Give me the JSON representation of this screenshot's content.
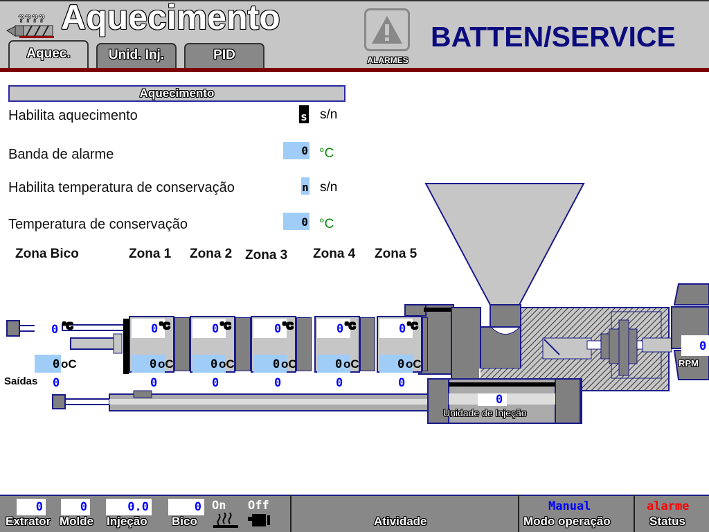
{
  "header": {
    "title": "Aquecimento",
    "tabs": [
      {
        "label": "Aquec.",
        "active": true
      },
      {
        "label": "Unid. Inj.",
        "active": false
      },
      {
        "label": "PID",
        "active": false
      }
    ],
    "alarm_button_label": "ALARMES",
    "brand": "BATTEN/SERVICE"
  },
  "section": {
    "title": "Aquecimento",
    "rows": [
      {
        "label": "Habilita aquecimento",
        "value": "s",
        "unit": "s/n"
      },
      {
        "label": "Banda de alarme",
        "value": "0",
        "unit": "°C"
      },
      {
        "label": "Habilita temperatura de conservação",
        "value": "n",
        "unit": "s/n"
      },
      {
        "label": "Temperatura de conservação",
        "value": "0",
        "unit": "°C"
      }
    ]
  },
  "zones": {
    "labels": [
      "Zona Bico",
      "Zona 1",
      "Zona 2",
      "Zona 3",
      "Zona 4",
      "Zona 5"
    ],
    "setpoint_unit": "°C",
    "actual_unit": "oC",
    "outputs_label": "Saídas",
    "items": [
      {
        "setpoint": "0",
        "actual": "0",
        "output": "0"
      },
      {
        "setpoint": "0",
        "actual": "0",
        "output": "0"
      },
      {
        "setpoint": "0",
        "actual": "0",
        "output": "0"
      },
      {
        "setpoint": "0",
        "actual": "0",
        "output": "0"
      },
      {
        "setpoint": "0",
        "actual": "0",
        "output": "0"
      },
      {
        "setpoint": "0",
        "actual": "0",
        "output": "0"
      }
    ]
  },
  "injection_unit": {
    "label": "Unidade de Injeção",
    "value": "0"
  },
  "motor": {
    "label": "RPM",
    "value": "0"
  },
  "footer": {
    "fields": [
      {
        "label": "Extrator",
        "value": "0"
      },
      {
        "label": "Molde",
        "value": "0"
      },
      {
        "label": "Injeção",
        "value": "0.0"
      },
      {
        "label": "Bico",
        "value": "0"
      }
    ],
    "heater_state": "On",
    "motor_state": "Off",
    "activity_label": "Atividade",
    "mode_value": "Manual",
    "mode_label": "Modo operação",
    "status_value": "alarme",
    "status_label": "Status"
  },
  "colors": {
    "brand": "#0b0b7e",
    "header_bg": "#c6c6c6",
    "accent_line": "#7d0000",
    "input_bg": "#9fcdf8",
    "mode_color": "#0000ff",
    "status_color": "#ff0000"
  }
}
